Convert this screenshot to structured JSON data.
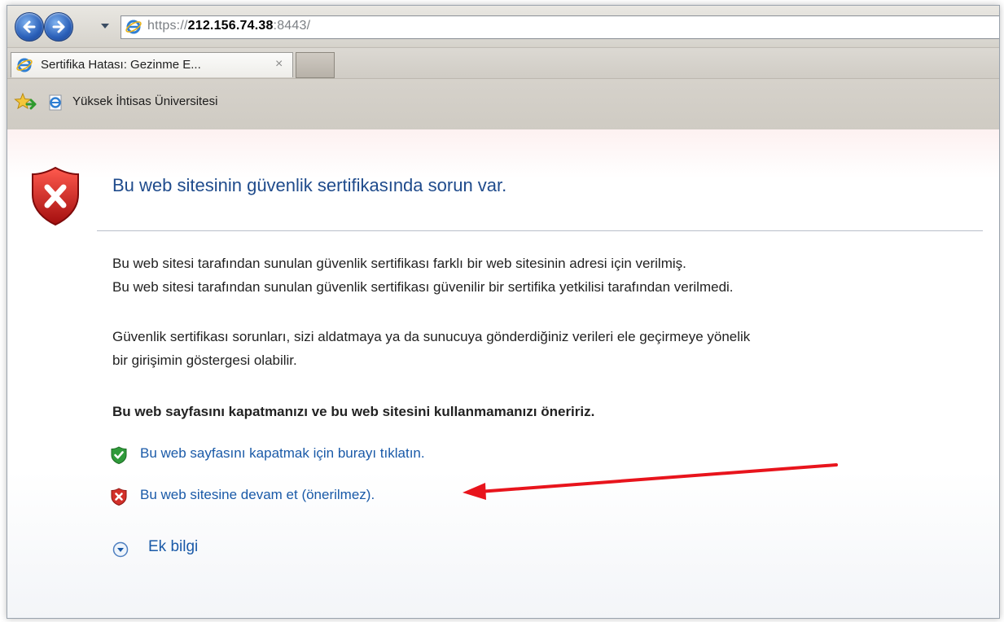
{
  "address_bar": {
    "url_scheme": "https://",
    "url_host": "212.156.74.38",
    "url_rest": ":8443/"
  },
  "tabs": [
    {
      "title": "Sertifika Hatası: Gezinme E...",
      "close_glyph": "×"
    }
  ],
  "favorites": {
    "items": [
      {
        "label": "Yüksek İhtisas Üniversitesi"
      }
    ]
  },
  "page": {
    "heading": "Bu web sitesinin güvenlik sertifikasında sorun var.",
    "paragraph1_line1": "Bu web sitesi tarafından sunulan güvenlik sertifikası farklı bir web sitesinin adresi için verilmiş.",
    "paragraph1_line2": "Bu web sitesi tarafından sunulan güvenlik sertifikası güvenilir bir sertifika yetkilisi tarafından verilmedi.",
    "paragraph2_line1": "Güvenlik sertifikası sorunları, sizi aldatmaya ya da sunucuya gönderdiğiniz verileri ele geçirmeye yönelik",
    "paragraph2_line2": "bir girişimin göstergesi olabilir.",
    "recommendation": "Bu web sayfasını kapatmanızı ve bu web sitesini kullanmamanızı öneririz.",
    "close_link": "Bu web sayfasını kapatmak için burayı tıklatın.",
    "continue_link": "Bu web sitesine devam et (önerilmez).",
    "more_info": "Ek bilgi"
  },
  "icons": {
    "back": "back-arrow-icon",
    "forward": "forward-arrow-icon",
    "browser": "internet-explorer-icon",
    "warning": "red-shield-x-icon",
    "safe": "green-shield-check-icon",
    "expand": "chevron-down-circle-icon"
  },
  "colors": {
    "link": "#1a5aa8",
    "heading": "#1f4b8c",
    "annotation_arrow": "#e8141c"
  }
}
